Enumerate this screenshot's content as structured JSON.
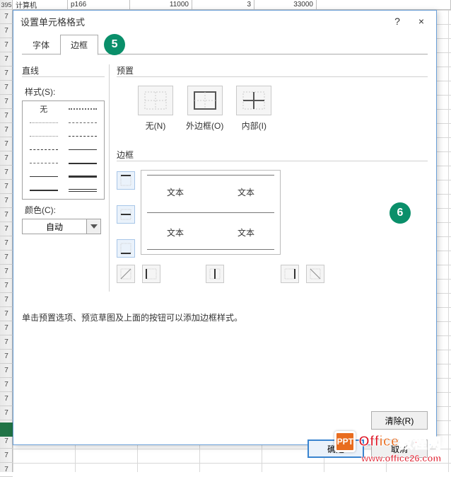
{
  "sheet": {
    "row_label_first": "395",
    "row_labels_repeat": "7",
    "visible_cells": [
      "计算机",
      "p166",
      "11000",
      "3",
      "33000"
    ]
  },
  "dialog": {
    "title": "设置单元格格式",
    "help_icon": "?",
    "close_icon": "×",
    "tabs": {
      "font": "字体",
      "border": "边框"
    },
    "badges": {
      "five": "5",
      "six": "6"
    },
    "line_group": "直线",
    "style_label": "样式(S):",
    "style_none": "无",
    "color_label": "颜色(C):",
    "color_value": "自动",
    "preset_group": "预置",
    "presets": {
      "none": "无(N)",
      "outline": "外边框(O)",
      "inside": "内部(I)"
    },
    "border_group": "边框",
    "preview_text": "文本",
    "hint": "单击预置选项、预览草图及上面的按钮可以添加边框样式。",
    "clear_btn": "清除(R)",
    "ok_btn": "确定",
    "cancel_btn": "取消"
  },
  "watermark": {
    "icon_text": "PPT",
    "text_a": "Off",
    "text_b": "ice",
    "text_c": "教程网",
    "url": "www.office26.com"
  }
}
